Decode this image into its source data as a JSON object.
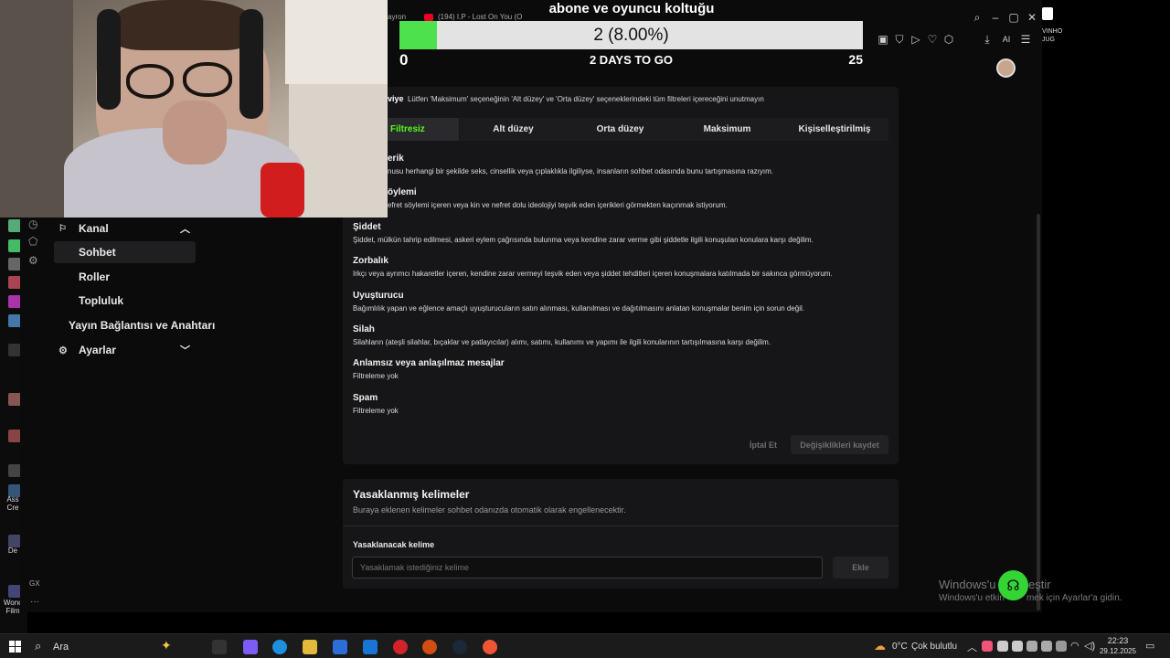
{
  "goal": {
    "title": "abone ve oyuncu koltuğu",
    "progress_text": "2 (8.00%)",
    "progress_fraction": 0.08,
    "min": "0",
    "max": "25",
    "days_left": "2 DAYS TO GO"
  },
  "browser": {
    "tab1_label": "ayron",
    "tab2_label": "(194) I.P - Lost On You (O",
    "side_text1": "VINHO",
    "side_text2": "JUG"
  },
  "sidebar": {
    "kanal": "Kanal",
    "sohbet": "Sohbet",
    "roller": "Roller",
    "topluluk": "Topluluk",
    "yayin": "Yayın Bağlantısı ve Anahtarı",
    "ayarlar": "Ayarlar"
  },
  "filter": {
    "heading_prefix": "viye",
    "heading_note": "Lütfen 'Maksimum' seçeneğinin 'Alt düzey' ve 'Orta düzey' seçeneklerindeki tüm filtreleri içereceğini unutmayın",
    "tabs": [
      "Filtresiz",
      "Alt düzey",
      "Orta düzey",
      "Maksimum",
      "Kişiselleştirilmiş"
    ],
    "categories": [
      {
        "title": "erik",
        "desc": "nusu herhangi bir şekilde seks, cinsellik veya çıplaklıkla ilgiliyse, insanların sohbet odasında bunu tartışmasına razıyım."
      },
      {
        "title": "öylemi",
        "desc": "efret söylemi içeren veya kin ve nefret dolu ideolojiyi teşvik eden içerikleri görmekten kaçınmak istiyorum."
      },
      {
        "title": "Şiddet",
        "desc": "Şiddet, mülkün tahrip edilmesi, askeri eylem çağrısında bulunma veya kendine zarar verme gibi şiddetle ilgili konuşulan konulara karşı değilim."
      },
      {
        "title": "Zorbalık",
        "desc": "Irkçı veya ayrımcı hakaretler içeren, kendine zarar vermeyi teşvik eden veya şiddet tehditleri içeren konuşmalara katılmada bir sakınca görmüyorum."
      },
      {
        "title": "Uyuşturucu",
        "desc": "Bağımlılık yapan ve eğlence amaçlı uyuşturucuların satın alınması, kullanılması ve dağıtılmasını anlatan konuşmalar benim için sorun değil."
      },
      {
        "title": "Silah",
        "desc": "Silahların (ateşli silahlar, bıçaklar ve patlayıcılar) alımı, satımı, kullanımı ve yapımı ile ilgili konularının tartışılmasına karşı değilim."
      },
      {
        "title": "Anlamsız veya anlaşılmaz mesajlar",
        "desc": "Filtreleme yok"
      },
      {
        "title": "Spam",
        "desc": "Filtreleme yok"
      }
    ],
    "cancel": "İptal Et",
    "save": "Değişiklikleri kaydet"
  },
  "banned": {
    "title": "Yasaklanmış kelimeler",
    "desc": "Buraya eklenen kelimeler sohbet odanızda otomatik olarak engellenecektir.",
    "label": "Yasaklanacak kelime",
    "placeholder": "Yasaklamak istediğiniz kelime",
    "add": "Ekle"
  },
  "watermark": {
    "line1": "Windows'u",
    "line1b": "eştir",
    "line2": "Windows'u etkin",
    "line2b": "mek için Ayarlar'a gidin."
  },
  "desktop": {
    "label1": "Ass",
    "label1b": "Cre",
    "label2": "De",
    "label3": "Wonc",
    "label3b": "Film",
    "gx": "GX"
  },
  "taskbar": {
    "search": "Ara",
    "weather": "0°C",
    "weather_desc": "Çok bulutlu",
    "time": "22:23",
    "date": "29.12.2025"
  },
  "colors": {
    "accent": "#53fc18",
    "goal_fill": "#4de24d",
    "panel": "#161618",
    "background": "#0b0b0c"
  }
}
